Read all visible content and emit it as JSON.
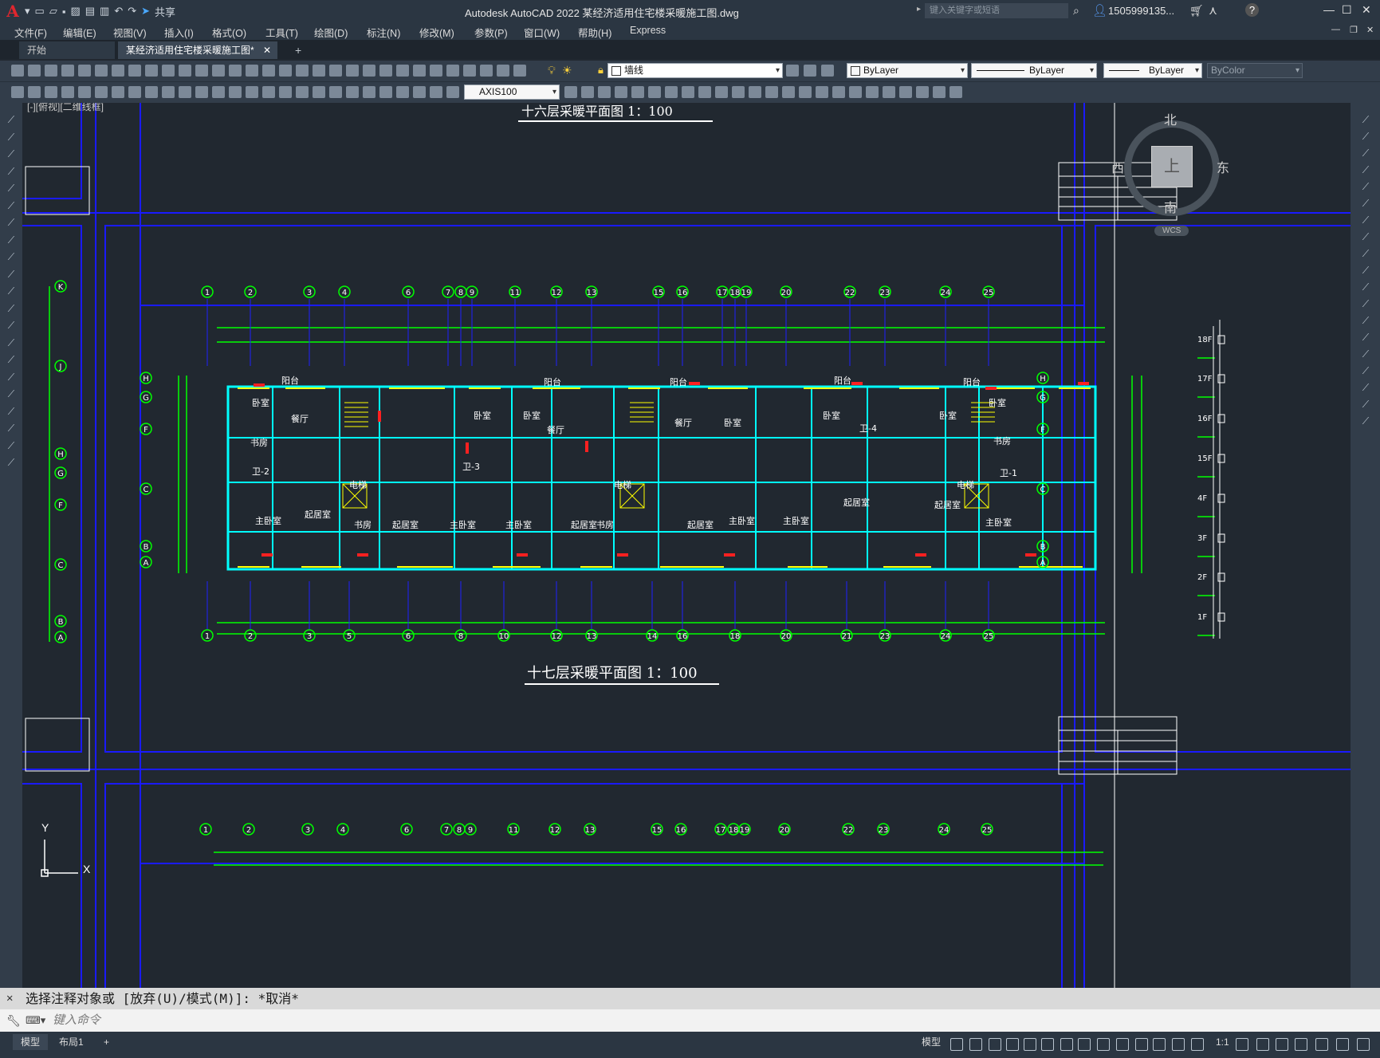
{
  "app": {
    "logo": "A",
    "title": "Autodesk AutoCAD 2022    某经济适用住宅楼采暖施工图.dwg",
    "share_label": "共享",
    "search_placeholder": "键入关键字或短语",
    "user": "1505999135...",
    "help": "?"
  },
  "menu": [
    "文件(F)",
    "编辑(E)",
    "视图(V)",
    "插入(I)",
    "格式(O)",
    "工具(T)",
    "绘图(D)",
    "标注(N)",
    "修改(M)",
    "参数(P)",
    "窗口(W)",
    "帮助(H)",
    "Express"
  ],
  "tabs": {
    "start": "开始",
    "document": "某经济适用住宅楼采暖施工图*",
    "close": "✕",
    "add": "+"
  },
  "toolbar": {
    "layer_name": "墙线",
    "color": "ByLayer",
    "linetype": "ByLayer",
    "lineweight": "ByLayer",
    "plotstyle": "ByColor",
    "dimstyle": "AXIS100"
  },
  "viewport": {
    "label": "[-][俯视][二维线框]"
  },
  "viewcube": {
    "north": "北",
    "south": "南",
    "east": "东",
    "west": "西",
    "top": "上",
    "wcs": "WCS"
  },
  "drawing": {
    "title_top": "十六层采暖平面图    1：100",
    "title_mid": "十七层采暖平面图    1：100",
    "top_axes": [
      "1",
      "2",
      "3",
      "4",
      "6",
      "7",
      "8",
      "9",
      "11",
      "12",
      "13",
      "15",
      "16",
      "17",
      "18",
      "19",
      "20",
      "22",
      "23",
      "24",
      "25"
    ],
    "bottom_axes": [
      "1",
      "2",
      "3",
      "5",
      "6",
      "8",
      "10",
      "12",
      "13",
      "14",
      "16",
      "18",
      "20",
      "21",
      "23",
      "24",
      "25"
    ],
    "row_axes_left": [
      "H",
      "G",
      "F",
      "C",
      "B",
      "A"
    ],
    "side_axes": [
      "K",
      "J",
      "H",
      "G",
      "F",
      "C",
      "B",
      "A"
    ],
    "rooms": [
      "阳台",
      "卧室",
      "餐厅",
      "书房",
      "主卧室",
      "起居室",
      "卫-3",
      "卫-4",
      "卫-1",
      "卫-2",
      "电梯"
    ],
    "floor_labels": [
      "18F",
      "17F",
      "16F",
      "15F",
      "4F",
      "3F",
      "2F",
      "1F"
    ],
    "ucs_x": "X",
    "ucs_y": "Y"
  },
  "command": {
    "history": "选择注释对象或 [放弃(U)/模式(M)]: *取消*",
    "prompt_placeholder": "键入命令"
  },
  "status": {
    "model_tab": "模型",
    "layout_tab": "布局1",
    "add": "+",
    "model_btn": "模型",
    "scale": "1:1"
  },
  "colors": {
    "canvas": "#212830",
    "frame_blue": "#1515ff",
    "green": "#00ff00",
    "cyan": "#00ffff",
    "yellow": "#ffff00",
    "red": "#ff2020",
    "white": "#ffffff"
  }
}
